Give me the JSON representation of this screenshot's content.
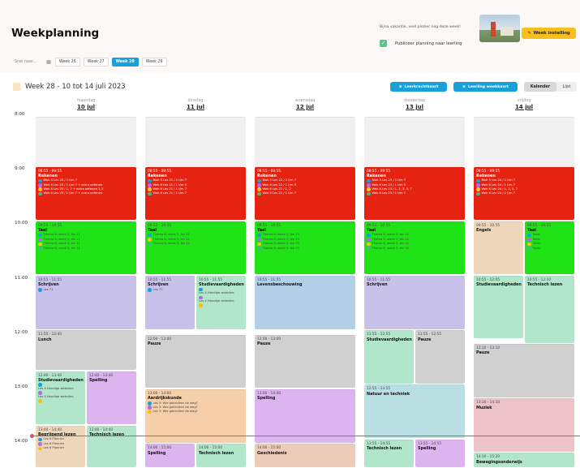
{
  "header": {
    "title": "Weekplanning",
    "goto_placeholder": "Snel naar...",
    "weeks": [
      {
        "label": "Week 26",
        "active": false
      },
      {
        "label": "Week 27",
        "active": false
      },
      {
        "label": "Week 28",
        "active": true
      },
      {
        "label": "Week 29",
        "active": false
      }
    ],
    "holiday_text": "Bijna vakantie, veel plezier nog deze week!",
    "publish_label": "Publiceer planning naar leerling",
    "publish_checked": true,
    "week_settings": "Week instelling"
  },
  "toolbar": {
    "week_title": "Week 28 - 10 tot 14 juli 2023",
    "btn_teacher": "Leerkrachtkaart",
    "btn_student": "Leerling weekkaart",
    "view_calendar": "Kalender",
    "view_list": "Lijst"
  },
  "colors": {
    "accent": "#1aa0d8",
    "settings": "#f7c01c",
    "rekenen": "#e62210",
    "taal": "#20e316",
    "now_line": "#e05050"
  },
  "days": [
    {
      "name": "maandag",
      "date": "10 jul"
    },
    {
      "name": "dinsdag",
      "date": "11 jul"
    },
    {
      "name": "woensdag",
      "date": "12 jul"
    },
    {
      "name": "donderdag",
      "date": "13 jul"
    },
    {
      "name": "vrijdag",
      "date": "14 jul"
    }
  ],
  "times": [
    "8:00",
    "9:00",
    "10:00",
    "11:00",
    "12:00",
    "13:00",
    "14:00"
  ],
  "events": [
    {
      "day": 0,
      "start": "8:00",
      "end": "9:00",
      "lane": 0,
      "lanes": 1,
      "color": "empty",
      "time": "",
      "name": "",
      "items": []
    },
    {
      "day": 1,
      "start": "8:00",
      "end": "9:00",
      "lane": 0,
      "lanes": 1,
      "color": "empty",
      "time": "",
      "name": "",
      "items": []
    },
    {
      "day": 2,
      "start": "8:00",
      "end": "9:00",
      "lane": 0,
      "lanes": 1,
      "color": "empty",
      "time": "",
      "name": "",
      "items": []
    },
    {
      "day": 3,
      "start": "8:00",
      "end": "9:00",
      "lane": 0,
      "lanes": 1,
      "color": "empty",
      "time": "",
      "name": "",
      "items": []
    },
    {
      "day": 4,
      "start": "8:00",
      "end": "9:00",
      "lane": 0,
      "lanes": 1,
      "color": "empty",
      "time": "",
      "name": "",
      "items": []
    },
    {
      "day": 0,
      "start": "8:55",
      "end": "9:55",
      "lane": 0,
      "lanes": 1,
      "color": "red",
      "time": "08:55 - 09:55",
      "name": "Rekenen",
      "items": [
        {
          "dot": "#1aa0d8",
          "text": "Blok 5 Les 25 / 1 t/m 7"
        },
        {
          "dot": "#b06ce8",
          "text": "Wek 6 Les 25 / 1 t/m 7 + extra oefenen"
        },
        {
          "dot": "#f7c01c",
          "text": "Wek 6 Les 25 / 1, 2 + extra oefenen 2,3"
        },
        {
          "dot": "#3cbf7a",
          "text": "Wek 6 Les 25 / 1 t/m 7 + extra oefenen"
        }
      ]
    },
    {
      "day": 1,
      "start": "8:55",
      "end": "9:55",
      "lane": 0,
      "lanes": 1,
      "color": "red",
      "time": "08:55 - 09:55",
      "name": "Rekenen",
      "items": [
        {
          "dot": "#1aa0d8",
          "text": "Blok 5 Les 21 / 1 t/m 7"
        },
        {
          "dot": "#b06ce8",
          "text": "Wek 6 Les 21 / 1 t/m 5"
        },
        {
          "dot": "#f7c01c",
          "text": "Wek 6 Les 21 / 1 t/m 7"
        },
        {
          "dot": "#3cbf7a",
          "text": "Wek 6 Les 21 / 1 t/m 7"
        }
      ]
    },
    {
      "day": 2,
      "start": "8:55",
      "end": "9:55",
      "lane": 0,
      "lanes": 1,
      "color": "red",
      "time": "08:55 - 09:55",
      "name": "Rekenen",
      "items": [
        {
          "dot": "#1aa0d8",
          "text": "Blok 5 Les 22 / 1 t/m 7"
        },
        {
          "dot": "#b06ce8",
          "text": "Wek 6 Les 22 / 1 t/m 5"
        },
        {
          "dot": "#f7c01c",
          "text": "Wek 6 Les 22 / 1, 2"
        },
        {
          "dot": "#3cbf7a",
          "text": "Wek 6 Les 22 / 1 t/m 7"
        }
      ]
    },
    {
      "day": 3,
      "start": "8:55",
      "end": "9:55",
      "lane": 0,
      "lanes": 1,
      "color": "red",
      "time": "08:55 - 09:55",
      "name": "Rekenen",
      "items": [
        {
          "dot": "#1aa0d8",
          "text": "Blok 5 Les 23 / 1 t/m 7"
        },
        {
          "dot": "#b06ce8",
          "text": "Wek 6 Les 23 / 1 t/m 5"
        },
        {
          "dot": "#f7c01c",
          "text": "Wek 6 Les 23 / 1, 2, 3, 5, 7"
        },
        {
          "dot": "#3cbf7a",
          "text": "Wek 6 Les 23 / 1 t/m 7"
        }
      ]
    },
    {
      "day": 4,
      "start": "8:55",
      "end": "9:55",
      "lane": 0,
      "lanes": 1,
      "color": "red",
      "time": "08:55 - 09:55",
      "name": "Rekenen",
      "items": [
        {
          "dot": "#1aa0d8",
          "text": "Blok 5 Les 24 / 1 t/m 7"
        },
        {
          "dot": "#b06ce8",
          "text": "Wek 6 Les 24 / 1 t/m 7"
        },
        {
          "dot": "#f7c01c",
          "text": "Wek 6 Les 24 / 1, 2, 5, 7"
        },
        {
          "dot": "#3cbf7a",
          "text": "Wek 6 Les 24 / 1 t/m 7"
        }
      ]
    },
    {
      "day": 0,
      "start": "9:55",
      "end": "10:55",
      "lane": 0,
      "lanes": 1,
      "color": "green",
      "time": "09:55 - 10:55",
      "name": "Taal",
      "items": [
        {
          "dot": "#1aa0d8",
          "text": "Thema 6, week 3, les 11"
        },
        {
          "dot": "#b06ce8",
          "text": "Thema 6, week 3, les 11"
        },
        {
          "dot": "#f7c01c",
          "text": "Thema 6, week 3, les 11"
        },
        {
          "dot": "#3cbf7a",
          "text": "Thema 6, week 3, les 11"
        }
      ]
    },
    {
      "day": 1,
      "start": "9:55",
      "end": "10:55",
      "lane": 0,
      "lanes": 1,
      "color": "green",
      "time": "09:55 - 10:55",
      "name": "Taal",
      "items": [
        {
          "dot": "#1aa0d8",
          "text": "Thema 6, week 3, les 12"
        },
        {
          "dot": "#f7c01c",
          "text": "Thema 6, week 3, les 12"
        },
        {
          "dot": "#3cbf7a",
          "text": "Thema 6, week 3, les 12"
        }
      ]
    },
    {
      "day": 2,
      "start": "9:55",
      "end": "10:55",
      "lane": 0,
      "lanes": 1,
      "color": "green",
      "time": "09:55 - 10:55",
      "name": "Taal",
      "items": [
        {
          "dot": "#1aa0d8",
          "text": "Thema 6, week 3, les 13"
        },
        {
          "dot": "#b06ce8",
          "text": "Thema 6, week 3, les 13"
        },
        {
          "dot": "#f7c01c",
          "text": "Thema 6, week 3, les 13"
        },
        {
          "dot": "#3cbf7a",
          "text": "Thema 6, week 3, les 13"
        }
      ]
    },
    {
      "day": 3,
      "start": "9:55",
      "end": "10:55",
      "lane": 0,
      "lanes": 1,
      "color": "green",
      "time": "09:55 - 10:55",
      "name": "Taal",
      "items": [
        {
          "dot": "#1aa0d8",
          "text": "Thema 6, week 3, les 14"
        },
        {
          "dot": "#b06ce8",
          "text": "Thema 6, week 3, les 14"
        },
        {
          "dot": "#f7c01c",
          "text": "Thema 6, week 3, les 14"
        },
        {
          "dot": "#3cbf7a",
          "text": "Thema 6, week 3, les 14"
        }
      ]
    },
    {
      "day": 4,
      "start": "9:55",
      "end": "10:55",
      "lane": 0,
      "lanes": 2,
      "color": "tan",
      "time": "09:55 - 10:55",
      "name": "Engels",
      "items": []
    },
    {
      "day": 4,
      "start": "9:55",
      "end": "10:55",
      "lane": 1,
      "lanes": 2,
      "color": "green",
      "time": "09:55 - 10:55",
      "name": "Taal",
      "items": [
        {
          "dot": "#1aa0d8",
          "text": "Toets"
        },
        {
          "dot": "#b06ce8",
          "text": "Toets"
        },
        {
          "dot": "#f7c01c",
          "text": "Toets"
        },
        {
          "dot": "#3cbf7a",
          "text": "Toets"
        }
      ]
    },
    {
      "day": 0,
      "start": "10:55",
      "end": "11:55",
      "lane": 0,
      "lanes": 1,
      "color": "purple",
      "time": "10:55 - 11:55",
      "name": "Schrijven",
      "items": [
        {
          "dot": "#1aa0d8",
          "text": "Les 71"
        }
      ]
    },
    {
      "day": 1,
      "start": "10:55",
      "end": "11:55",
      "lane": 0,
      "lanes": 2,
      "color": "purple",
      "time": "10:55 - 11:55",
      "name": "Schrijven",
      "items": [
        {
          "dot": "#1aa0d8",
          "text": "Les 72"
        }
      ]
    },
    {
      "day": 1,
      "start": "10:55",
      "end": "11:55",
      "lane": 1,
      "lanes": 2,
      "color": "mint",
      "time": "10:55 - 11:55",
      "name": "Studievaardigheden",
      "items": [
        {
          "dot": "#1aa0d8",
          "text": ""
        },
        {
          "dot": "",
          "text": "Les 4 Handige websites"
        },
        {
          "dot": "#b06ce8",
          "text": ""
        },
        {
          "dot": "",
          "text": "Les 4 Handige websites"
        },
        {
          "dot": "#f7c01c",
          "text": ""
        }
      ]
    },
    {
      "day": 2,
      "start": "10:55",
      "end": "11:55",
      "lane": 0,
      "lanes": 1,
      "color": "blue",
      "time": "10:55 - 11:55",
      "name": "Levensbeschouwing",
      "items": []
    },
    {
      "day": 3,
      "start": "10:55",
      "end": "11:55",
      "lane": 0,
      "lanes": 1,
      "color": "purple",
      "time": "10:55 - 11:55",
      "name": "Schrijven",
      "items": []
    },
    {
      "day": 4,
      "start": "10:55",
      "end": "12:05",
      "lane": 0,
      "lanes": 2,
      "color": "mint",
      "time": "10:55 - 12:05",
      "name": "Studievaardigheden",
      "items": []
    },
    {
      "day": 4,
      "start": "10:55",
      "end": "12:10",
      "lane": 1,
      "lanes": 2,
      "color": "mint",
      "time": "10:55 - 12:10",
      "name": "Technisch lezen",
      "items": []
    },
    {
      "day": 0,
      "start": "11:55",
      "end": "12:40",
      "lane": 0,
      "lanes": 1,
      "color": "gray",
      "time": "11:55 - 12:40",
      "name": "Lunch",
      "items": []
    },
    {
      "day": 1,
      "start": "12:00",
      "end": "13:00",
      "lane": 0,
      "lanes": 1,
      "color": "gray",
      "time": "12:00 - 13:00",
      "name": "Pauze",
      "items": []
    },
    {
      "day": 2,
      "start": "12:00",
      "end": "13:00",
      "lane": 0,
      "lanes": 1,
      "color": "gray",
      "time": "12:00 - 13:00",
      "name": "Pauze",
      "items": []
    },
    {
      "day": 3,
      "start": "11:55",
      "end": "12:55",
      "lane": 0,
      "lanes": 2,
      "color": "mint",
      "time": "11:55 - 12:55",
      "name": "Studievaardigheden",
      "items": []
    },
    {
      "day": 3,
      "start": "11:55",
      "end": "12:55",
      "lane": 1,
      "lanes": 2,
      "color": "gray",
      "time": "11:55 - 12:55",
      "name": "Pauze",
      "items": []
    },
    {
      "day": 4,
      "start": "12:10",
      "end": "13:10",
      "lane": 0,
      "lanes": 1,
      "color": "gray",
      "time": "12:10 - 13:10",
      "name": "Pauze",
      "items": []
    },
    {
      "day": 0,
      "start": "12:40",
      "end": "13:40",
      "lane": 0,
      "lanes": 2,
      "color": "mint",
      "time": "12:40 - 13:40",
      "name": "Studievaardigheden",
      "items": [
        {
          "dot": "#1aa0d8",
          "text": ""
        },
        {
          "dot": "",
          "text": "Les 4 Handige websites"
        },
        {
          "dot": "#b06ce8",
          "text": ""
        },
        {
          "dot": "",
          "text": "Les 4 Handige websites"
        },
        {
          "dot": "#f7c01c",
          "text": ""
        }
      ]
    },
    {
      "day": 0,
      "start": "12:40",
      "end": "13:40",
      "lane": 1,
      "lanes": 2,
      "color": "lav",
      "time": "12:40 - 13:40",
      "name": "Spelling",
      "items": []
    },
    {
      "day": 1,
      "start": "13:00",
      "end": "14:00",
      "lane": 0,
      "lanes": 1,
      "color": "peach",
      "time": "13:00 - 14:00",
      "name": "Aardrijkskunde",
      "items": [
        {
          "dot": "#1aa0d8",
          "text": "Les 3: Wie gebruiken de weg?"
        },
        {
          "dot": "#b06ce8",
          "text": "Les 3: Wie gebruiken de weg?"
        },
        {
          "dot": "#f7c01c",
          "text": "Les 3: Wie gebruiken de weg?"
        }
      ]
    },
    {
      "day": 2,
      "start": "13:00",
      "end": "14:00",
      "lane": 0,
      "lanes": 1,
      "color": "lav",
      "time": "13:00 - 14:00",
      "name": "Spelling",
      "items": []
    },
    {
      "day": 3,
      "start": "12:55",
      "end": "13:55",
      "lane": 0,
      "lanes": 1,
      "color": "teal",
      "time": "12:55 - 13:55",
      "name": "Natuur en techniek",
      "items": []
    },
    {
      "day": 4,
      "start": "13:10",
      "end": "14:10",
      "lane": 0,
      "lanes": 1,
      "color": "pink",
      "time": "13:10 - 14:10",
      "name": "Muziek",
      "items": []
    },
    {
      "day": 0,
      "start": "13:40",
      "end": "14:40",
      "lane": 0,
      "lanes": 2,
      "color": "tan",
      "time": "13:40 - 14:40",
      "name": "Begrijpend lezen",
      "items": [
        {
          "dot": "#1aa0d8",
          "text": "Les 6 Plannen"
        },
        {
          "dot": "#b06ce8",
          "text": "Les 6 Plannen"
        },
        {
          "dot": "#f7c01c",
          "text": "Les 6 Plannen"
        }
      ]
    },
    {
      "day": 0,
      "start": "13:40",
      "end": "14:40",
      "lane": 1,
      "lanes": 2,
      "color": "mint",
      "time": "13:40 - 14:40",
      "name": "Technisch lezen",
      "items": []
    },
    {
      "day": 1,
      "start": "14:00",
      "end": "15:00",
      "lane": 0,
      "lanes": 2,
      "color": "lav",
      "time": "14:00 - 15:00",
      "name": "Spelling",
      "items": []
    },
    {
      "day": 1,
      "start": "14:00",
      "end": "15:00",
      "lane": 1,
      "lanes": 2,
      "color": "mint",
      "time": "14:00 - 15:00",
      "name": "Technisch lezen",
      "items": []
    },
    {
      "day": 2,
      "start": "14:00",
      "end": "15:00",
      "lane": 0,
      "lanes": 1,
      "color": "salmon",
      "time": "14:00 - 15:00",
      "name": "Geschiedenis",
      "items": []
    },
    {
      "day": 3,
      "start": "13:55",
      "end": "14:55",
      "lane": 0,
      "lanes": 2,
      "color": "mint",
      "time": "13:55 - 14:55",
      "name": "Technisch lezen",
      "items": []
    },
    {
      "day": 3,
      "start": "13:55",
      "end": "14:55",
      "lane": 1,
      "lanes": 2,
      "color": "lav",
      "time": "13:55 - 14:55",
      "name": "Spelling",
      "items": []
    },
    {
      "day": 4,
      "start": "14:10",
      "end": "15:20",
      "lane": 0,
      "lanes": 1,
      "color": "mint",
      "time": "14:10 - 15:20",
      "name": "Bewegingsonderwijs",
      "items": []
    }
  ]
}
